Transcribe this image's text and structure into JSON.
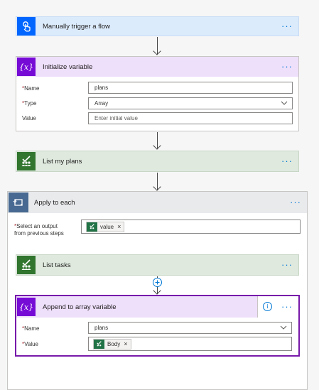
{
  "trigger": {
    "title": "Manually trigger a flow",
    "icon": "touch-icon",
    "color": "#0066ff"
  },
  "init_var": {
    "title": "Initialize variable",
    "icon": "variable-icon",
    "color": "#770bd6",
    "fields": {
      "name_label": "Name",
      "name_value": "plans",
      "type_label": "Type",
      "type_value": "Array",
      "value_label": "Value",
      "value_placeholder": "Enter initial value"
    }
  },
  "list_plans": {
    "title": "List my plans",
    "icon": "planner-icon",
    "color": "#31752f"
  },
  "apply_each": {
    "title": "Apply to each",
    "icon": "loop-icon",
    "select_label_line1": "Select an output",
    "select_label_line2": "from previous steps",
    "token": "value"
  },
  "list_tasks": {
    "title": "List tasks",
    "icon": "planner-icon"
  },
  "append": {
    "title": "Append to array variable",
    "name_label": "Name",
    "name_value": "plans",
    "value_label": "Value",
    "token": "Body",
    "border_color": "#7719aa"
  },
  "more_glyph": "···",
  "required_mark": "*",
  "remove_glyph": "×"
}
